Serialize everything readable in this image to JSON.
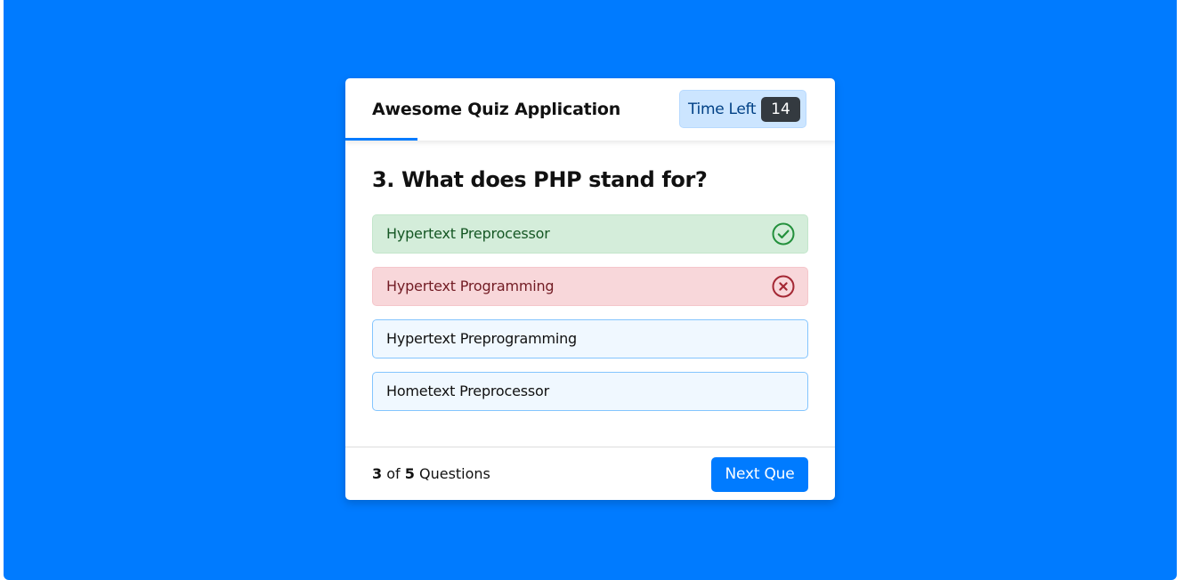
{
  "header": {
    "title": "Awesome Quiz Application",
    "timer_label": "Time Left",
    "timer_seconds": "14"
  },
  "question": {
    "text": "3. What does PHP stand for?"
  },
  "options": [
    {
      "label": "Hypertext Preprocessor",
      "state": "correct",
      "icon": "check-circle-icon"
    },
    {
      "label": "Hypertext Programming",
      "state": "incorrect",
      "icon": "x-circle-icon"
    },
    {
      "label": "Hypertext Preprogramming",
      "state": "neutral"
    },
    {
      "label": "Hometext Preprocessor",
      "state": "neutral"
    }
  ],
  "footer": {
    "current": "3",
    "of_text": "of",
    "total": "5",
    "questions_text": "Questions",
    "next_label": "Next Que"
  },
  "colors": {
    "background": "#007bff",
    "accent": "#007bff",
    "correct_bg": "#d4edda",
    "correct_fg": "#155724",
    "incorrect_bg": "#f8d7da",
    "incorrect_fg": "#721c24",
    "option_bg": "#f0f8ff"
  }
}
